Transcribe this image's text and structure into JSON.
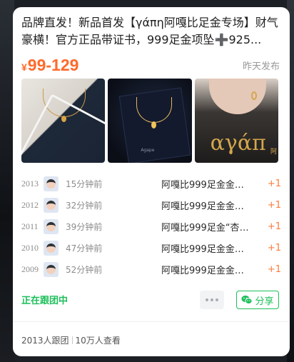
{
  "post": {
    "title": "品牌直发！新品首发【γάπη阿嘎比足金专场】财气豪横！官方正品带证书，999足金项坠➕925...",
    "price_symbol": "¥",
    "price_range": "99-129",
    "posted": "昨天发布"
  },
  "images": [
    {
      "icon": "necklace-photo"
    },
    {
      "icon": "gift-box-photo",
      "brand": "Agape"
    },
    {
      "icon": "model-photo",
      "logo": "αγάπ",
      "logo_cn": "阿"
    }
  ],
  "participants": [
    {
      "num": "2013",
      "ago": "15分钟前",
      "item": "阿嘎比999足金金…",
      "qty": "+1"
    },
    {
      "num": "2012",
      "ago": "32分钟前",
      "item": "阿嘎比999足金金…",
      "qty": "+1"
    },
    {
      "num": "2011",
      "ago": "39分钟前",
      "item": "阿嘎比999足金“杏”…",
      "qty": "+1"
    },
    {
      "num": "2010",
      "ago": "47分钟前",
      "item": "阿嘎比999足金金…",
      "qty": "+1"
    },
    {
      "num": "2009",
      "ago": "52分钟前",
      "item": "阿嘎比999足金金…",
      "qty": "+1"
    }
  ],
  "actions": {
    "following": "正在跟团中",
    "share": "分享"
  },
  "footer": {
    "joined": "2013人跟团",
    "views": "10万人查看"
  },
  "colors": {
    "accent": "#ff6a2a",
    "green": "#1dbf5a"
  }
}
